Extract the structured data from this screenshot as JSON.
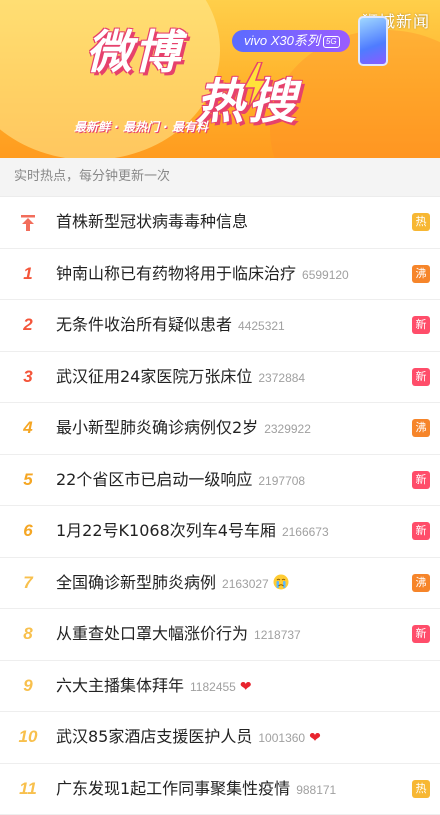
{
  "banner": {
    "title_part1": "微博",
    "title_part2": "热搜",
    "tagline": "最新鲜 · 最热门 · 最有料",
    "sponsor_label": "vivo X30系列",
    "sponsor_badge": "5G",
    "watermark": "狮城新闻"
  },
  "subheader": "实时热点，每分钟更新一次",
  "tag_colors": {
    "热": "#f7b733",
    "沸": "#f6852a",
    "新": "#ff4d6a"
  },
  "items": [
    {
      "rank": "",
      "topic": "首株新型冠状病毒毒种信息",
      "count": "",
      "tag": "热",
      "emoji": "",
      "pinned": true
    },
    {
      "rank": "1",
      "topic": "钟南山称已有药物将用于临床治疗",
      "count": "6599120",
      "tag": "沸",
      "emoji": ""
    },
    {
      "rank": "2",
      "topic": "无条件收治所有疑似患者",
      "count": "4425321",
      "tag": "新",
      "emoji": ""
    },
    {
      "rank": "3",
      "topic": "武汉征用24家医院万张床位",
      "count": "2372884",
      "tag": "新",
      "emoji": ""
    },
    {
      "rank": "4",
      "topic": "最小新型肺炎确诊病例仅2岁",
      "count": "2329922",
      "tag": "沸",
      "emoji": ""
    },
    {
      "rank": "5",
      "topic": "22个省区市已启动一级响应",
      "count": "2197708",
      "tag": "新",
      "emoji": ""
    },
    {
      "rank": "6",
      "topic": "1月22号K1068次列车4号车厢",
      "count": "2166673",
      "tag": "新",
      "emoji": ""
    },
    {
      "rank": "7",
      "topic": "全国确诊新型肺炎病例",
      "count": "2163027",
      "tag": "沸",
      "emoji": "crying-face"
    },
    {
      "rank": "8",
      "topic": "从重查处口罩大幅涨价行为",
      "count": "1218737",
      "tag": "新",
      "emoji": ""
    },
    {
      "rank": "9",
      "topic": "六大主播集体拜年",
      "count": "1182455",
      "tag": "",
      "emoji": "heart"
    },
    {
      "rank": "10",
      "topic": "武汉85家酒店支援医护人员",
      "count": "1001360",
      "tag": "",
      "emoji": "heart"
    },
    {
      "rank": "11",
      "topic": "广东发现1起工作同事聚集性疫情",
      "count": "988171",
      "tag": "热",
      "emoji": ""
    }
  ]
}
